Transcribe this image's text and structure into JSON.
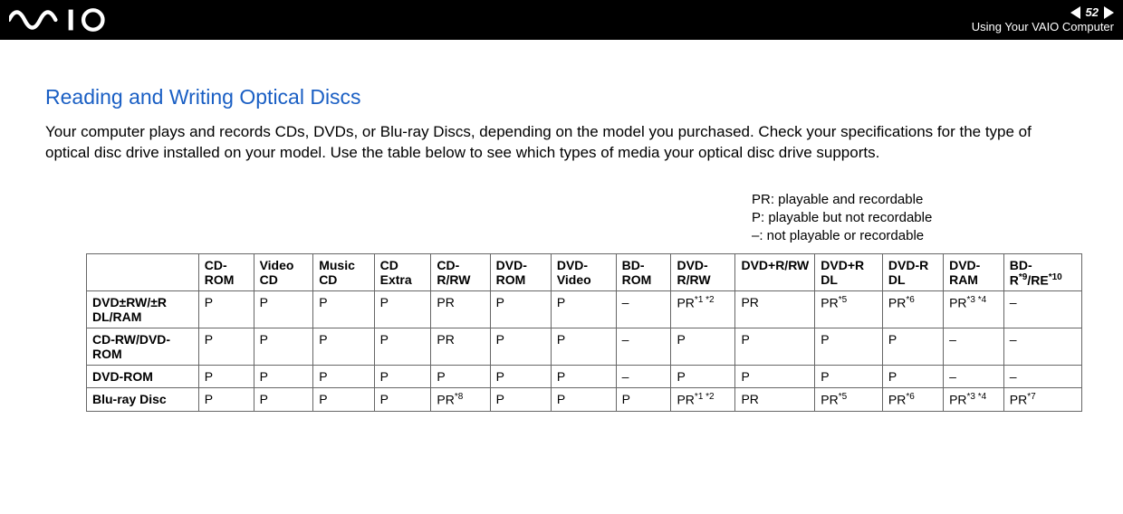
{
  "header": {
    "page_number": "52",
    "section_label": "Using Your VAIO Computer",
    "logo_text": "VAIO"
  },
  "main": {
    "title": "Reading and Writing Optical Discs",
    "intro": "Your computer plays and records CDs, DVDs, or Blu-ray Discs, depending on the model you purchased. Check your specifications for the type of optical disc drive installed on your model. Use the table below to see which types of media your optical disc drive supports.",
    "legend_lines": {
      "l1": "PR: playable and recordable",
      "l2": "P: playable but not recordable",
      "l3": "–: not playable or recordable"
    }
  },
  "table": {
    "columns": {
      "c1": "CD-ROM",
      "c2": "Video CD",
      "c3": "Music CD",
      "c4": "CD Extra",
      "c5": "CD-R/RW",
      "c6": "DVD-ROM",
      "c7": "DVD-Video",
      "c8": "BD-ROM",
      "c9": "DVD-R/RW",
      "c10": "DVD+R/RW",
      "c11": "DVD+R DL",
      "c12": "DVD-R DL",
      "c13": "DVD-RAM",
      "c14_a": "BD-R",
      "c14_sup1": "*9",
      "c14_b": "/RE",
      "c14_sup2": "*10"
    },
    "rows": {
      "r1": {
        "label": "DVD±RW/±R DL/RAM",
        "c1": "P",
        "c2": "P",
        "c3": "P",
        "c4": "P",
        "c5": "PR",
        "c6": "P",
        "c7": "P",
        "c8": "–",
        "c9_a": "PR",
        "c9_sup": "*1 *2",
        "c10": "PR",
        "c11_a": "PR",
        "c11_sup": "*5",
        "c12_a": "PR",
        "c12_sup": "*6",
        "c13_a": "PR",
        "c13_sup": "*3 *4",
        "c14": "–"
      },
      "r2": {
        "label": "CD-RW/DVD-ROM",
        "c1": "P",
        "c2": "P",
        "c3": "P",
        "c4": "P",
        "c5": "PR",
        "c6": "P",
        "c7": "P",
        "c8": "–",
        "c9": "P",
        "c10": "P",
        "c11": "P",
        "c12": "P",
        "c13": "–",
        "c14": "–"
      },
      "r3": {
        "label": "DVD-ROM",
        "c1": "P",
        "c2": "P",
        "c3": "P",
        "c4": "P",
        "c5": "P",
        "c6": "P",
        "c7": "P",
        "c8": "–",
        "c9": "P",
        "c10": "P",
        "c11": "P",
        "c12": "P",
        "c13": "–",
        "c14": "–"
      },
      "r4": {
        "label": "Blu-ray Disc",
        "c1": "P",
        "c2": "P",
        "c3": "P",
        "c4": "P",
        "c5_a": "PR",
        "c5_sup": "*8",
        "c6": "P",
        "c7": "P",
        "c8": "P",
        "c9_a": "PR",
        "c9_sup": "*1 *2",
        "c10": "PR",
        "c11_a": "PR",
        "c11_sup": "*5",
        "c12_a": "PR",
        "c12_sup": "*6",
        "c13_a": "PR",
        "c13_sup": "*3 *4",
        "c14_a": "PR",
        "c14_sup": "*7"
      }
    }
  }
}
